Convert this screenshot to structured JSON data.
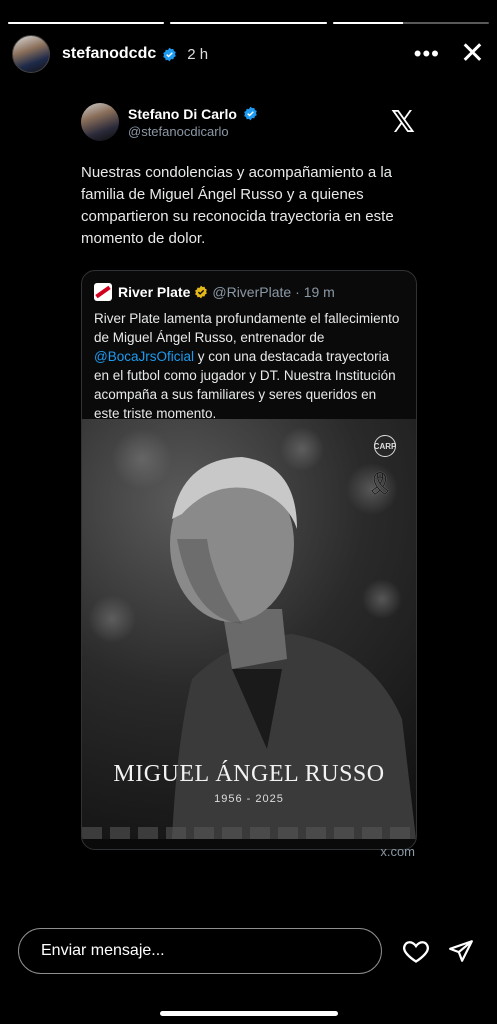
{
  "progress": [
    1,
    1,
    0.45
  ],
  "story": {
    "username": "stefanodcdc",
    "time": "2 h",
    "more_icon": "more-horizontal-icon",
    "close_icon": "close-icon"
  },
  "tweet": {
    "display_name": "Stefano Di Carlo",
    "handle": "@stefanocdicarlo",
    "text": "Nuestras condolencias y acompañamiento a la familia de Miguel Ángel Russo y a quienes compartieron su reconocida trayectoria en este momento de dolor.",
    "quote": {
      "display_name": "River Plate",
      "handle": "@RiverPlate",
      "time": "· 19 m",
      "text_before": "River Plate lamenta profundamente el fallecimiento de Miguel Ángel Russo, entrenador de ",
      "mention": "@BocaJrsOficial",
      "text_after": " y con una destacada trayectoria en el futbol como jugador y DT. Nuestra Institución acompaña a sus familiares y seres queridos en este triste momento.",
      "image": {
        "name": "MIGUEL ÁNGEL RUSSO",
        "years": "1956 - 2025",
        "badge": "CARP"
      }
    },
    "source": "x.com"
  },
  "reply": {
    "placeholder": "Enviar mensaje..."
  },
  "colors": {
    "verified_blue": "#1d9bf0",
    "verified_gold": "#e2b719",
    "link": "#1d9bf0"
  }
}
